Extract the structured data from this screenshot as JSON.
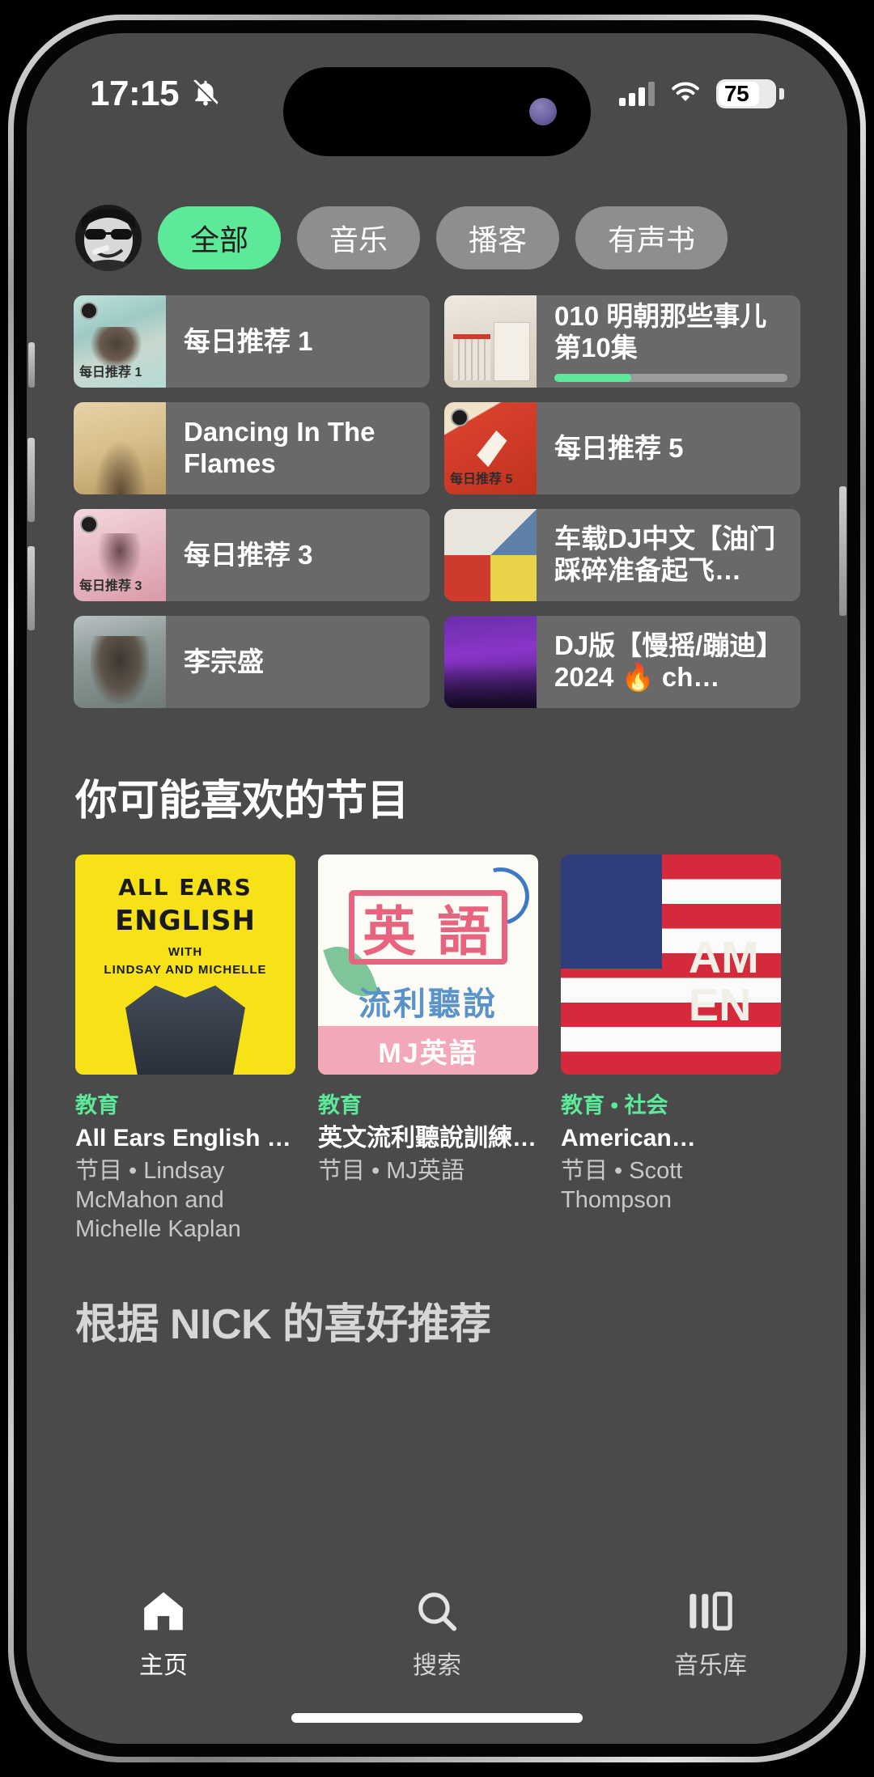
{
  "status_bar": {
    "time": "17:15",
    "mute_icon": "bell-slash-icon",
    "signal_icon": "cellular-signal-icon",
    "wifi_icon": "wifi-icon",
    "battery_level": "75",
    "battery_percent": 75
  },
  "header": {
    "avatar_alt": "user-avatar",
    "chips": [
      {
        "label": "全部",
        "active": true
      },
      {
        "label": "音乐",
        "active": false
      },
      {
        "label": "播客",
        "active": false
      },
      {
        "label": "有声书",
        "active": false
      }
    ]
  },
  "shortcuts": [
    {
      "title": "每日推荐 1",
      "art": "art-daily1",
      "caption": "每日推荐 1",
      "badge": true,
      "progress": null
    },
    {
      "title": "010 明朝那些事儿 第10集",
      "art": "art-mingchao",
      "caption": "",
      "badge": false,
      "progress": 33
    },
    {
      "title": "Dancing In The Flames",
      "art": "art-dancing",
      "caption": "",
      "badge": false,
      "progress": null
    },
    {
      "title": "每日推荐 5",
      "art": "art-daily5",
      "caption": "每日推荐 5",
      "badge": true,
      "progress": null
    },
    {
      "title": "每日推荐 3",
      "art": "art-daily3",
      "caption": "每日推荐 3",
      "badge": true,
      "progress": null
    },
    {
      "title": "车载DJ中文【油门踩碎准备起飞…",
      "art": "art-dj",
      "caption": "",
      "badge": false,
      "progress": null
    },
    {
      "title": "李宗盛",
      "art": "art-lizongsheng",
      "caption": "",
      "badge": false,
      "progress": null
    },
    {
      "title": "DJ版【慢摇/蹦迪】2024 🔥 ch…",
      "art": "art-djparty",
      "caption": "",
      "badge": false,
      "progress": null
    }
  ],
  "sections": {
    "podcasts_title": "你可能喜欢的节目",
    "nick_title": "根据 NICK 的喜好推荐"
  },
  "podcasts": [
    {
      "category": "教育",
      "name": "All Ears English Podcast",
      "byline": "节目 • Lindsay McMahon and Michelle Kaplan",
      "cover": "cover-allears",
      "cover_text": {
        "line1": "ALL EARS",
        "line2": "ENGLISH",
        "line3": "WITH",
        "line4": "LINDSAY    AND   MICHELLE"
      }
    },
    {
      "category": "教育",
      "name": "英文流利聽說訓練 | MJ…",
      "byline": "节目 • MJ英語",
      "cover": "cover-mj",
      "cover_text": {
        "line1": "英 語",
        "line2": "流利聽說",
        "line3": "MJ英語",
        "line4": ""
      }
    },
    {
      "category": "教育 • 社会",
      "name": "American…",
      "byline": "节目 • Scott Thompson",
      "cover": "cover-usa",
      "cover_text": {
        "line1": "AM",
        "line2": "EN",
        "line3": "",
        "line4": ""
      }
    }
  ],
  "tabbar": [
    {
      "label": "主页",
      "icon": "home-icon",
      "active": true
    },
    {
      "label": "搜索",
      "icon": "search-icon",
      "active": false
    },
    {
      "label": "音乐库",
      "icon": "library-icon",
      "active": false
    }
  ],
  "colors": {
    "accent_green": "#5ce99a",
    "screen_bg": "#4a4a4a",
    "card_bg": "#696969",
    "chip_bg": "#8e8e8e"
  }
}
